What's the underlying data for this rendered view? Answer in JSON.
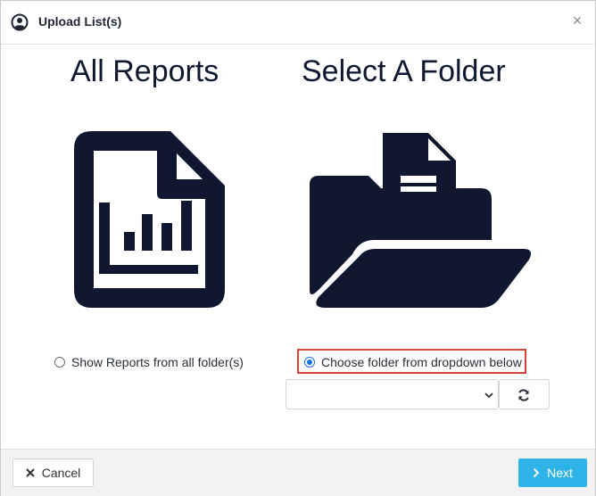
{
  "dialog": {
    "title": "Upload List(s)",
    "close_label": "×"
  },
  "left": {
    "heading": "All Reports",
    "option_label": "Show Reports from all folder(s)",
    "option_selected": false
  },
  "right": {
    "heading": "Select A Folder",
    "option_label": "Choose folder from dropdown below",
    "option_selected": true,
    "folder_select_value": ""
  },
  "footer": {
    "cancel_label": "Cancel",
    "next_label": "Next"
  },
  "colors": {
    "icon": "#0f1830",
    "highlight": "#d9443a",
    "primary": "#2eb4e8",
    "radio_checked": "#1a73e8"
  },
  "icons": {
    "header": "user-circle-icon",
    "left_big": "file-chart-icon",
    "right_big": "folder-open-icon",
    "refresh": "refresh-icon",
    "cancel": "close-icon",
    "next": "chevron-right-icon"
  }
}
